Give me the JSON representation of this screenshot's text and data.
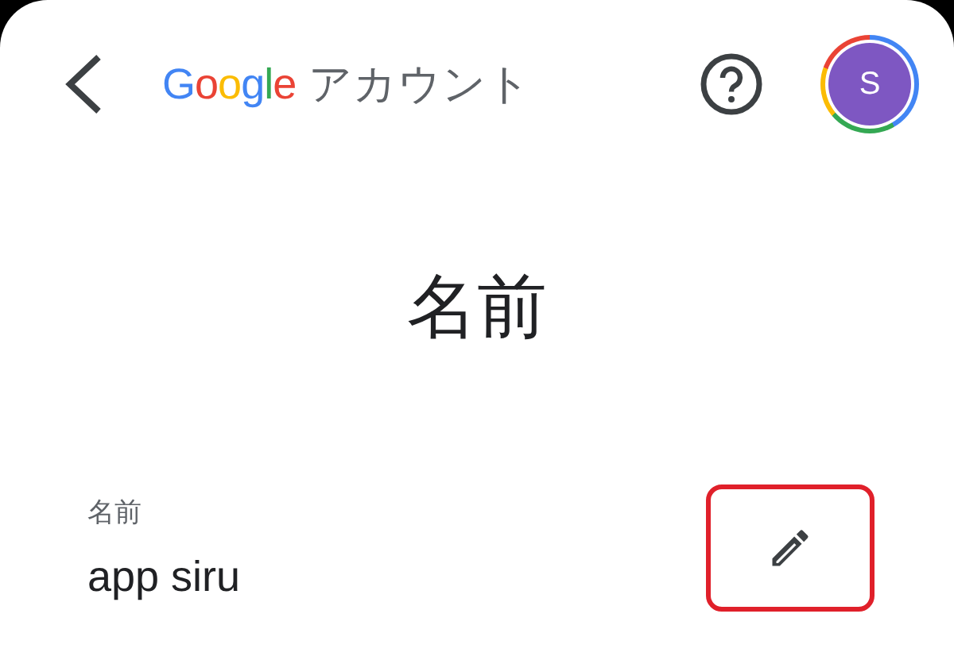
{
  "header": {
    "logo": "Google",
    "product": "アカウント",
    "avatar_initial": "S"
  },
  "title": "名前",
  "field": {
    "label": "名前",
    "value": "app siru",
    "edit_highlighted": true
  }
}
